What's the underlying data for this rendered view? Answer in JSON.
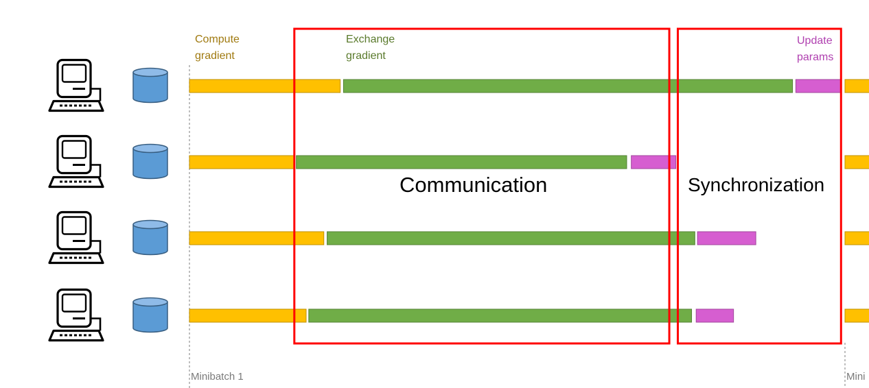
{
  "labels": {
    "compute": [
      "Compute",
      "gradient"
    ],
    "exchange": [
      "Exchange",
      "gradient"
    ],
    "update": [
      "Update",
      "params"
    ]
  },
  "regions": {
    "communication": "Communication",
    "synchronization": "Synchronization"
  },
  "ticks": [
    "Minibatch 1",
    "Mini"
  ],
  "colors": {
    "compute": "#ffc000",
    "exchange": "#70ad47",
    "update": "#d65ed0",
    "region": "#ff0000",
    "disk": "#5b9bd5"
  },
  "icons": [
    "computer-icon",
    "disk-icon"
  ],
  "chart_data": {
    "type": "gantt",
    "workers": 4,
    "segments": [
      [
        {
          "phase": "compute",
          "start": 0.0,
          "end": 0.23
        },
        {
          "phase": "exchange",
          "start": 0.235,
          "end": 0.92
        },
        {
          "phase": "update",
          "start": 0.925,
          "end": 0.994
        },
        {
          "phase": "compute",
          "start": 1.0,
          "end": 1.04
        }
      ],
      [
        {
          "phase": "compute",
          "start": 0.0,
          "end": 0.16
        },
        {
          "phase": "exchange",
          "start": 0.163,
          "end": 0.667
        },
        {
          "phase": "update",
          "start": 0.674,
          "end": 0.742
        },
        {
          "phase": "compute",
          "start": 1.0,
          "end": 1.04
        }
      ],
      [
        {
          "phase": "compute",
          "start": 0.0,
          "end": 0.205
        },
        {
          "phase": "exchange",
          "start": 0.21,
          "end": 0.771
        },
        {
          "phase": "update",
          "start": 0.775,
          "end": 0.864
        },
        {
          "phase": "compute",
          "start": 1.0,
          "end": 1.04
        }
      ],
      [
        {
          "phase": "compute",
          "start": 0.0,
          "end": 0.178
        },
        {
          "phase": "exchange",
          "start": 0.182,
          "end": 0.766
        },
        {
          "phase": "update",
          "start": 0.773,
          "end": 0.83
        },
        {
          "phase": "compute",
          "start": 1.0,
          "end": 1.04
        }
      ]
    ],
    "regions": [
      {
        "name": "Communication",
        "start": 0.16,
        "end": 0.732
      },
      {
        "name": "Synchronization",
        "start": 0.745,
        "end": 0.994
      }
    ]
  }
}
